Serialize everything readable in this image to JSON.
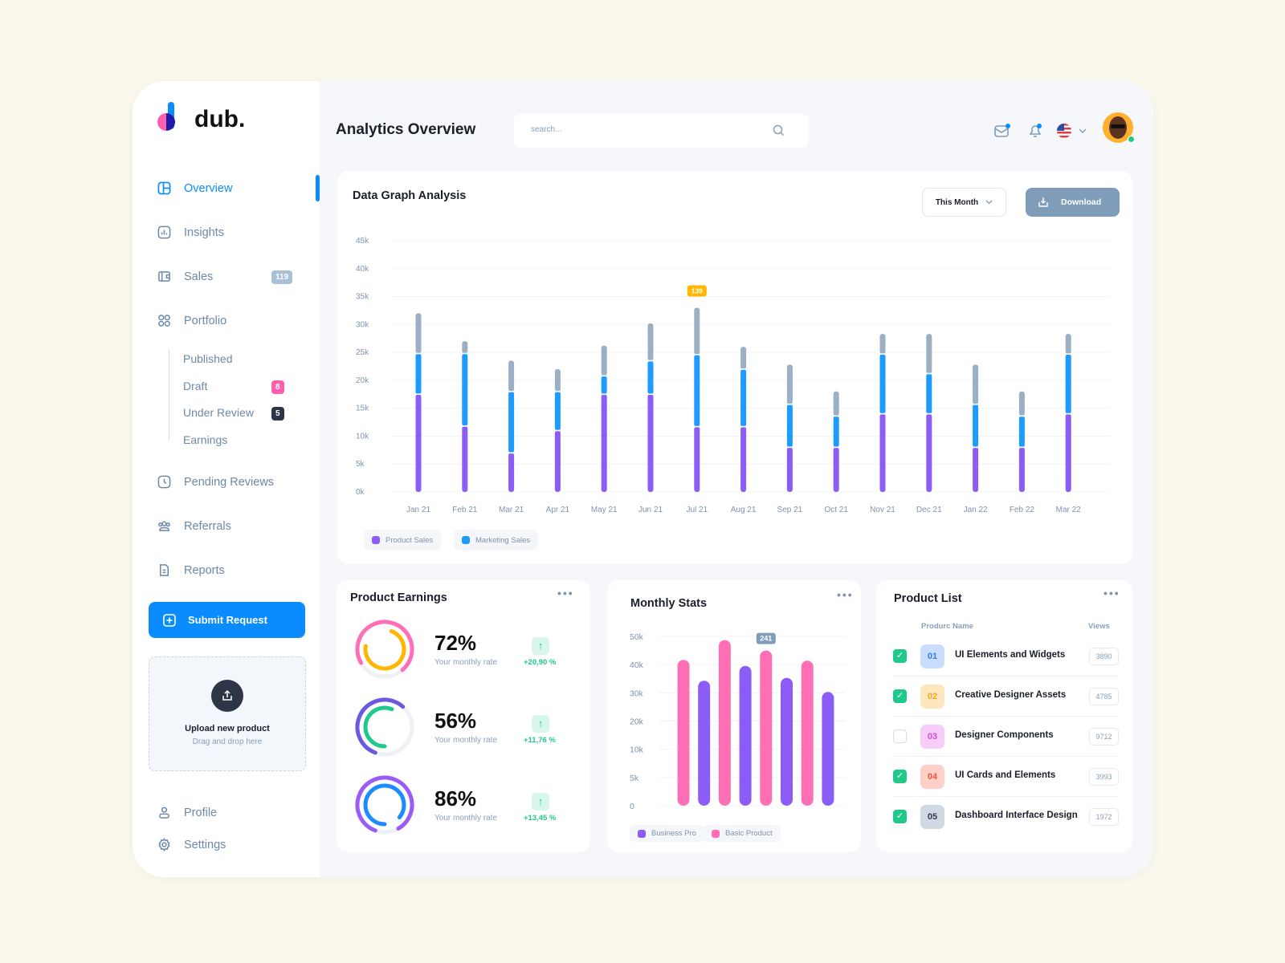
{
  "brand": {
    "name": "dub."
  },
  "sidebar": {
    "items": [
      {
        "label": "Overview",
        "icon": "layout-icon",
        "active": true
      },
      {
        "label": "Insights",
        "icon": "bar-chart-icon"
      },
      {
        "label": "Sales",
        "icon": "wallet-icon",
        "badge": "119"
      },
      {
        "label": "Portfolio",
        "icon": "grid-icon"
      }
    ],
    "portfolio_sub": [
      {
        "label": "Published"
      },
      {
        "label": "Draft",
        "badge": "8"
      },
      {
        "label": "Under Review",
        "badge": "5"
      },
      {
        "label": "Earnings"
      }
    ],
    "items2": [
      {
        "label": "Pending Reviews",
        "icon": "clock-icon"
      },
      {
        "label": "Referrals",
        "icon": "users-icon"
      },
      {
        "label": "Reports",
        "icon": "document-icon"
      }
    ],
    "submit_label": "Submit Request",
    "upload": {
      "title": "Upload new product",
      "subtitle": "Drag and drop here"
    },
    "profile_label": "Profile",
    "settings_label": "Settings"
  },
  "header": {
    "title": "Analytics Overview",
    "search_placeholder": "search...",
    "language": "US flag"
  },
  "colors": {
    "accent": "#0a8cff",
    "product": "#8b5cf6",
    "marketing": "#1e9bff",
    "other": "#9bb0c4",
    "pink": "#ff6fb5",
    "green": "#1fc98a"
  },
  "graph": {
    "title": "Data Graph Analysis",
    "period": "This Month",
    "download_label": "Download",
    "tooltip": "139"
  },
  "chart_data": [
    {
      "type": "bar",
      "stacked": true,
      "title": "Data Graph Analysis",
      "categories": [
        "Jan 21",
        "Feb 21",
        "Mar 21",
        "Apr 21",
        "May 21",
        "Jun 21",
        "Jul 21",
        "Aug 21",
        "Sep 21",
        "Oct 21",
        "Nov 21",
        "Dec 21",
        "Jan 22",
        "Feb 22",
        "Mar 22"
      ],
      "series": [
        {
          "name": "Product Sales",
          "color": "#8b5cf6",
          "values": [
            17500,
            11800,
            7000,
            11000,
            17500,
            17500,
            11700,
            11700,
            8000,
            8000,
            14000,
            14000,
            8000,
            8000,
            14000
          ]
        },
        {
          "name": "Marketing Sales",
          "color": "#1e9bff",
          "values": [
            7300,
            13000,
            11000,
            7000,
            3300,
            6000,
            12900,
            10300,
            7700,
            5600,
            10700,
            7200,
            7700,
            5600,
            10700
          ]
        },
        {
          "color": "#9bb0c4",
          "values": [
            7200,
            2200,
            5500,
            4000,
            5400,
            6700,
            8400,
            4000,
            7100,
            4400,
            3600,
            7100,
            7100,
            4400,
            3600
          ]
        }
      ],
      "yticks": [
        "0k",
        "5k",
        "10k",
        "15k",
        "20k",
        "25k",
        "30k",
        "35k",
        "40k",
        "45k"
      ],
      "ylim": [
        0,
        45000
      ],
      "grid": true,
      "legend": "bottom-left",
      "annotation": {
        "category": "Jul 21",
        "label": "139"
      }
    },
    {
      "type": "bar",
      "title": "Monthly Stats",
      "yticks": [
        "0",
        "5k",
        "10k",
        "20k",
        "30k",
        "40k",
        "50k"
      ],
      "ytick_values": [
        0,
        5000,
        10000,
        20000,
        30000,
        40000,
        50000
      ],
      "bars": [
        {
          "series": "Basic Product",
          "value": 41700
        },
        {
          "series": "Business Pro",
          "value": 34300
        },
        {
          "series": "Basic Product",
          "value": 48700
        },
        {
          "series": "Business Pro",
          "value": 39500
        },
        {
          "series": "Basic Product",
          "value": 45000
        },
        {
          "series": "Business Pro",
          "value": 35300
        },
        {
          "series": "Basic Product",
          "value": 41400
        },
        {
          "series": "Business Pro",
          "value": 30300
        }
      ],
      "series": [
        {
          "name": "Business Pro",
          "color": "#8b5cf6"
        },
        {
          "name": "Basic Product",
          "color": "#ff6fb5"
        }
      ],
      "annotation": {
        "bar": 5,
        "label": "241"
      },
      "legend": "bottom-left"
    }
  ],
  "earnings": {
    "title": "Product Earnings",
    "items": [
      {
        "percent": "72%",
        "value": 72,
        "rate_label": "Your monthly rate",
        "change": "+20,90 %",
        "outer": "#ff6fb5",
        "inner": "#ffb703"
      },
      {
        "percent": "56%",
        "value": 56,
        "rate_label": "Your monthly rate",
        "change": "+11,76 %",
        "outer": "#6a5ae0",
        "inner": "#1fc98a"
      },
      {
        "percent": "86%",
        "value": 86,
        "rate_label": "Your monthly rate",
        "change": "+13,45 %",
        "outer": "#9b5cf6",
        "inner": "#1e8bff"
      }
    ]
  },
  "monthly": {
    "title": "Monthly Stats"
  },
  "products": {
    "title": "Product List",
    "col_name": "Produrc Name",
    "col_views": "Views",
    "rows": [
      {
        "num": "01",
        "name": "UI Elements and Widgets",
        "views": "3890",
        "checked": true,
        "bg": "#c9defe",
        "fg": "#2f7cf6"
      },
      {
        "num": "02",
        "name": "Creative Designer Assets",
        "views": "4785",
        "checked": true,
        "bg": "#ffe7bd",
        "fg": "#f5a524"
      },
      {
        "num": "03",
        "name": "Designer Components",
        "views": "9712",
        "checked": false,
        "bg": "#f5cdf8",
        "fg": "#d24ae0"
      },
      {
        "num": "04",
        "name": "UI Cards and Elements",
        "views": "3993",
        "checked": true,
        "bg": "#ffd0c7",
        "fg": "#f0573b"
      },
      {
        "num": "05",
        "name": "Dashboard Interface Design",
        "views": "1972",
        "checked": true,
        "bg": "#cfd8e3",
        "fg": "#2c3a4b"
      }
    ]
  }
}
